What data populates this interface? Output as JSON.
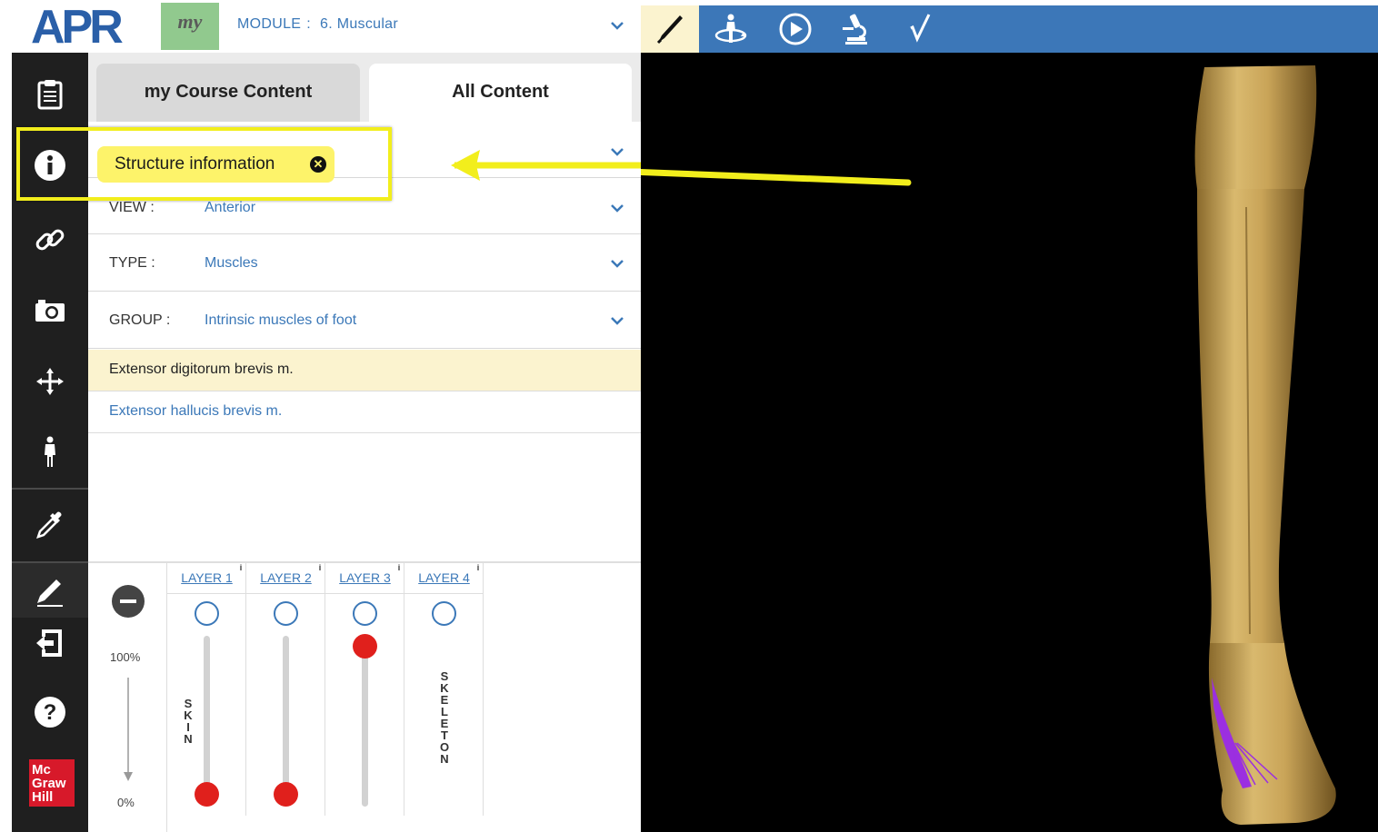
{
  "header": {
    "logo_text": "APR",
    "logo_small": "&",
    "my_badge": "my",
    "module_label": "MODULE",
    "module_sep": ":",
    "module_value": "6. Muscular"
  },
  "sidebar": {
    "icons": [
      "clipboard-icon",
      "info-icon",
      "link-icon",
      "camera-icon",
      "move-icon",
      "human-figure-icon",
      "eyedropper-icon",
      "pencil-icon",
      "exit-icon",
      "help-icon"
    ],
    "publisher_logo": [
      "Mc",
      "Graw",
      "Hill"
    ]
  },
  "tabs": [
    {
      "label": "my Course Content",
      "active": false
    },
    {
      "label": "All Content",
      "active": true
    }
  ],
  "filters": [
    {
      "label": "VIEW :",
      "value": "Anterior"
    },
    {
      "label": "TYPE :",
      "value": "Muscles"
    },
    {
      "label": "GROUP :",
      "value": "Intrinsic muscles of foot"
    }
  ],
  "results": [
    {
      "label": "Extensor digitorum brevis m.",
      "selected": true
    },
    {
      "label": "Extensor hallucis brevis m.",
      "selected": false
    }
  ],
  "tooltip": {
    "text": "Structure information",
    "close_glyph": "✕",
    "highlight_color": "#f2ee1c"
  },
  "layers": {
    "opacity_max": "100%",
    "opacity_min": "0%",
    "columns": [
      {
        "tab": "LAYER 1",
        "name": "SKIN",
        "slider_level": 0
      },
      {
        "tab": "LAYER 2",
        "name": "",
        "slider_level": 0
      },
      {
        "tab": "LAYER 3",
        "name": "",
        "slider_level": 1
      },
      {
        "tab": "LAYER 4",
        "name": "SKELETON",
        "slider_level": null
      }
    ]
  },
  "toolbar": {
    "icons": [
      "dissect-icon",
      "rotate-figure-icon",
      "play-icon",
      "microscope-icon",
      "quiz-check-icon"
    ],
    "active": "dissect-icon"
  },
  "colors": {
    "accent_blue": "#3c77b8",
    "link_blue": "#3b78b8",
    "selected_row": "#fbf3cf",
    "tooltip_yellow": "#fdf36a",
    "slider_red": "#e0201c",
    "highlight_muscle": "#9b2fe0"
  }
}
